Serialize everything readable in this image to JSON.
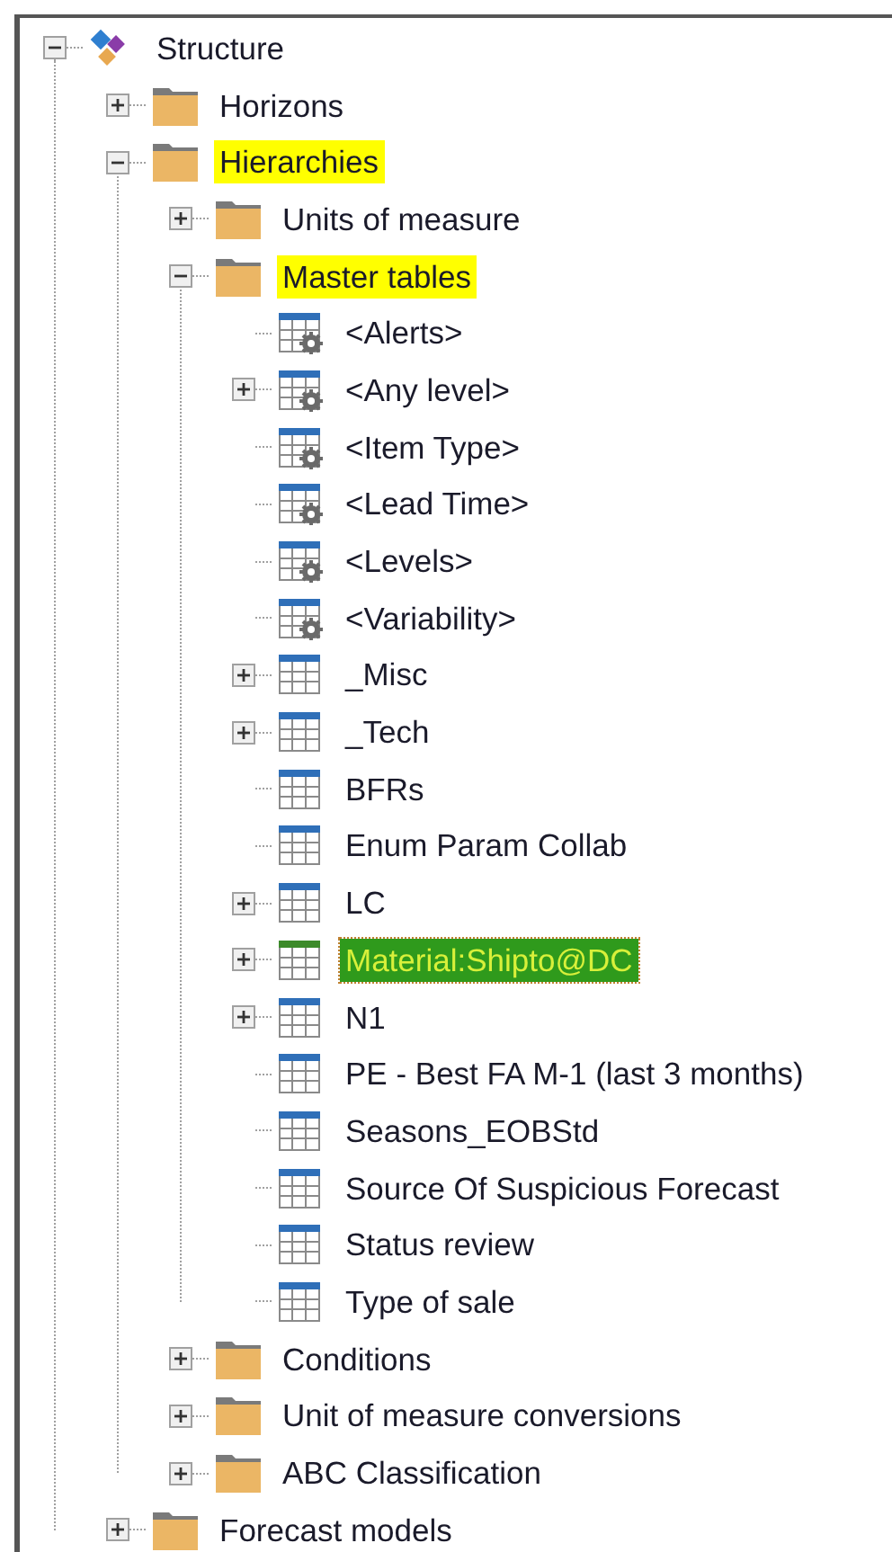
{
  "tree": [
    {
      "label": "Structure",
      "kind": "root",
      "expanded": true,
      "selected": false,
      "highlighted": false,
      "children": [
        {
          "label": "Horizons",
          "kind": "folder",
          "expanded": false,
          "selected": false,
          "highlighted": false
        },
        {
          "label": "Hierarchies",
          "kind": "folder",
          "expanded": true,
          "selected": false,
          "highlighted": true,
          "children": [
            {
              "label": "Units of measure",
              "kind": "folder",
              "expanded": false,
              "selected": false,
              "highlighted": false
            },
            {
              "label": "Master tables",
              "kind": "folder",
              "expanded": true,
              "selected": false,
              "highlighted": true,
              "children": [
                {
                  "label": "<Alerts>",
                  "kind": "table-gear",
                  "selected": false,
                  "highlighted": false
                },
                {
                  "label": "<Any level>",
                  "kind": "table-gear",
                  "expanded": false,
                  "selected": false,
                  "highlighted": false
                },
                {
                  "label": "<Item Type>",
                  "kind": "table-gear",
                  "selected": false,
                  "highlighted": false
                },
                {
                  "label": "<Lead Time>",
                  "kind": "table-gear",
                  "selected": false,
                  "highlighted": false
                },
                {
                  "label": "<Levels>",
                  "kind": "table-gear",
                  "selected": false,
                  "highlighted": false
                },
                {
                  "label": "<Variability>",
                  "kind": "table-gear",
                  "selected": false,
                  "highlighted": false
                },
                {
                  "label": "_Misc",
                  "kind": "table",
                  "expanded": false,
                  "selected": false,
                  "highlighted": false
                },
                {
                  "label": "_Tech",
                  "kind": "table",
                  "expanded": false,
                  "selected": false,
                  "highlighted": false
                },
                {
                  "label": "BFRs",
                  "kind": "table",
                  "selected": false,
                  "highlighted": false
                },
                {
                  "label": "Enum Param Collab",
                  "kind": "table",
                  "selected": false,
                  "highlighted": false
                },
                {
                  "label": "LC",
                  "kind": "table",
                  "expanded": false,
                  "selected": false,
                  "highlighted": false
                },
                {
                  "label": "Material:Shipto@DC",
                  "kind": "table",
                  "expanded": false,
                  "selected": true,
                  "highlighted": true
                },
                {
                  "label": "N1",
                  "kind": "table",
                  "expanded": false,
                  "selected": false,
                  "highlighted": false
                },
                {
                  "label": "PE - Best FA M-1 (last 3 months)",
                  "kind": "table",
                  "selected": false,
                  "highlighted": false
                },
                {
                  "label": "Seasons_EOBStd",
                  "kind": "table",
                  "selected": false,
                  "highlighted": false
                },
                {
                  "label": "Source Of Suspicious Forecast",
                  "kind": "table",
                  "selected": false,
                  "highlighted": false
                },
                {
                  "label": "Status review",
                  "kind": "table",
                  "selected": false,
                  "highlighted": false
                },
                {
                  "label": "Type of sale",
                  "kind": "table",
                  "selected": false,
                  "highlighted": false
                }
              ]
            },
            {
              "label": "Conditions",
              "kind": "folder",
              "expanded": false,
              "selected": false,
              "highlighted": false
            },
            {
              "label": "Unit of measure conversions",
              "kind": "folder",
              "expanded": false,
              "selected": false,
              "highlighted": false
            },
            {
              "label": "ABC Classification",
              "kind": "folder",
              "expanded": false,
              "selected": false,
              "highlighted": false
            }
          ]
        },
        {
          "label": "Forecast models",
          "kind": "folder",
          "expanded": false,
          "selected": false,
          "highlighted": false
        }
      ]
    }
  ]
}
